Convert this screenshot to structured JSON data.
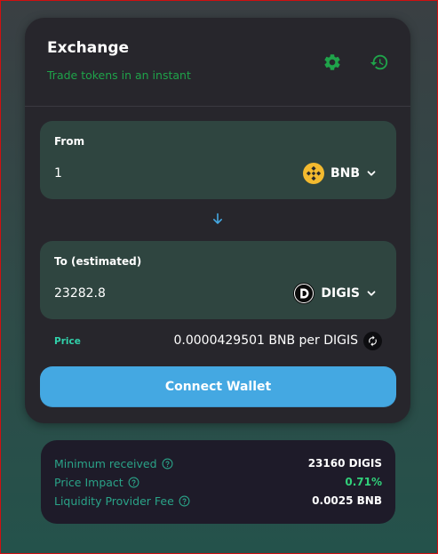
{
  "exchange": {
    "title": "Exchange",
    "subtitle": "Trade tokens in an instant",
    "settings_icon": "gear-icon",
    "history_icon": "history-icon"
  },
  "from": {
    "label": "From",
    "amount": "1",
    "token": "BNB",
    "token_icon": "bnb-logo"
  },
  "to": {
    "label": "To (estimated)",
    "amount": "23282.8",
    "token": "DIGIS",
    "token_icon": "digis-logo"
  },
  "price": {
    "label": "Price",
    "value": "0.0000429501 BNB per DIGIS"
  },
  "connect_label": "Connect Wallet",
  "details": {
    "minimum_received": {
      "label": "Minimum received",
      "value": "23160 DIGIS"
    },
    "price_impact": {
      "label": "Price Impact",
      "value": "0.71%"
    },
    "lp_fee": {
      "label": "Liquidity Provider Fee",
      "value": "0.0025 BNB"
    }
  },
  "colors": {
    "accent_green": "#1fa34a",
    "button_blue": "#44a8e2",
    "panel_bg": "#2f4540",
    "card_bg": "#27262c"
  }
}
